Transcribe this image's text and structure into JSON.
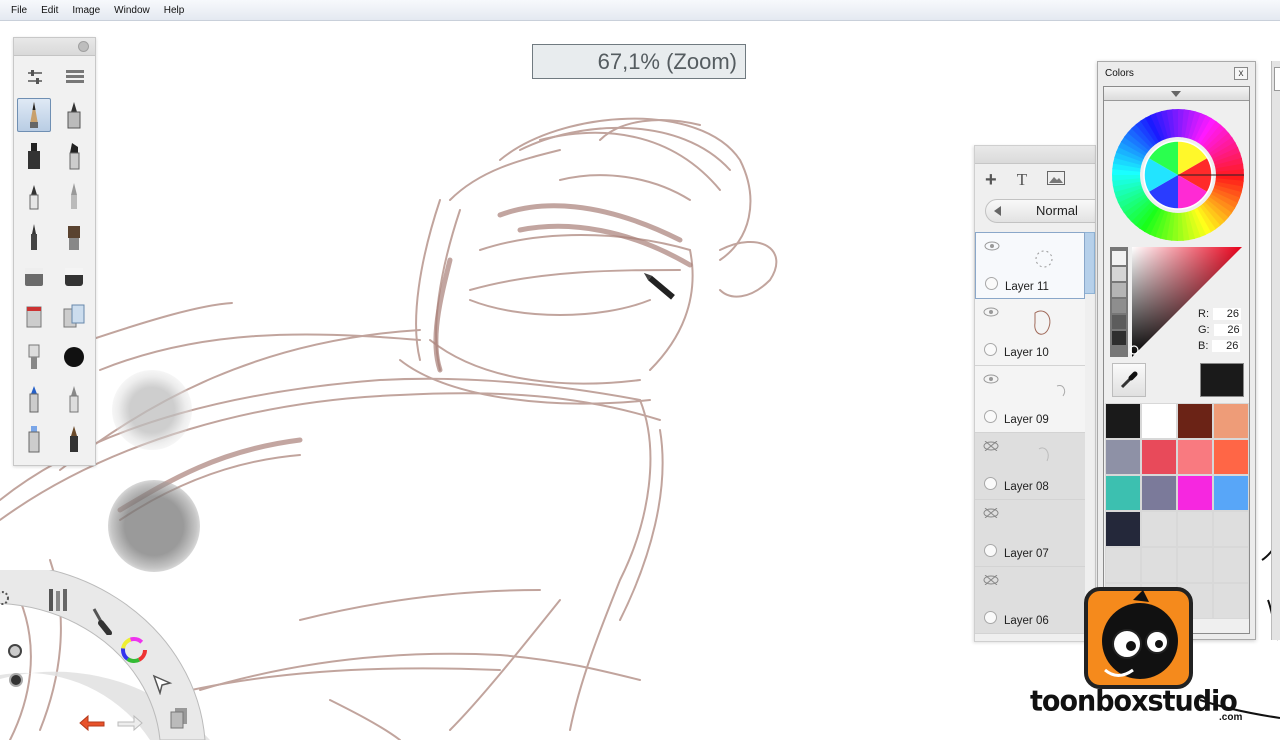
{
  "menu": [
    "File",
    "Edit",
    "Image",
    "Window",
    "Help"
  ],
  "zoom": {
    "label": "67,1% (Zoom)"
  },
  "toolbox": {
    "header_icons": [
      "sliders-icon",
      "stack-icon"
    ],
    "tools": [
      {
        "name": "pencil-tool",
        "selected": true
      },
      {
        "name": "technical-pen-tool"
      },
      {
        "name": "marker-tool"
      },
      {
        "name": "chisel-marker-tool"
      },
      {
        "name": "ballpoint-pen-tool"
      },
      {
        "name": "paintbrush-tool"
      },
      {
        "name": "fine-pen-tool"
      },
      {
        "name": "bristle-brush-tool"
      },
      {
        "name": "eraser-tool"
      },
      {
        "name": "hard-eraser-tool"
      },
      {
        "name": "paint-bucket-tool"
      },
      {
        "name": "multi-bucket-tool"
      },
      {
        "name": "smudge-brush-tool"
      },
      {
        "name": "airbrush-tool"
      },
      {
        "name": "blue-marker-tool"
      },
      {
        "name": "silver-pen-tool"
      },
      {
        "name": "highlighter-tool"
      },
      {
        "name": "ink-brush-tool"
      }
    ]
  },
  "layers": {
    "blend_mode": "Normal",
    "tool_icons": [
      "add-layer-icon",
      "text-layer-icon",
      "image-layer-icon"
    ],
    "items": [
      {
        "name": "Layer 11",
        "visible": true,
        "active": true
      },
      {
        "name": "Layer 10",
        "visible": true
      },
      {
        "name": "Layer 09",
        "visible": true
      },
      {
        "name": "Layer 08",
        "visible": false
      },
      {
        "name": "Layer 07",
        "visible": false
      },
      {
        "name": "Layer 06",
        "visible": false
      }
    ]
  },
  "colors": {
    "title": "Colors",
    "close": "x",
    "r_label": "R:",
    "g_label": "G:",
    "b_label": "B:",
    "r": "26",
    "g": "26",
    "b": "26",
    "current_color": "#1a1a1a",
    "swatches": [
      "#1a1a1a",
      "#ffffff",
      "#6b2316",
      "#ee9c78",
      "#8e91a6",
      "#e84a5a",
      "#f97a80",
      "#ff6646",
      "#3cc0b0",
      "#7b7a9a",
      "#f627e0",
      "#58a6f8",
      "#24283a",
      "#dedede",
      "#dedede",
      "#dedede",
      "#dedede",
      "#dedede",
      "#dedede",
      "#dedede",
      "#dedede",
      "#dedede",
      "#dedede",
      "#dedede"
    ]
  },
  "lagoon": {
    "icons": [
      "brush-properties-icon",
      "brush-icon",
      "color-wheel-icon",
      "select-arrow-icon",
      "zoom-icon",
      "undo-icon",
      "redo-icon",
      "layers-copy-icon"
    ]
  },
  "logo": {
    "brand": "toonboxstudio",
    "suffix": ".com"
  }
}
